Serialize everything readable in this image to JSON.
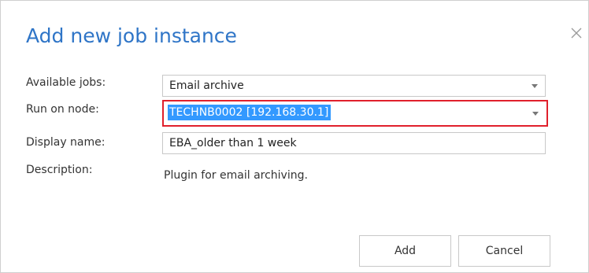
{
  "dialog": {
    "title": "Add new job instance",
    "close_icon": "close-icon"
  },
  "form": {
    "available_jobs": {
      "label": "Available jobs:",
      "value": "Email archive"
    },
    "run_on_node": {
      "label": "Run on node:",
      "value": "TECHNB0002 [192.168.30.1]"
    },
    "display_name": {
      "label": "Display name:",
      "value": "EBA_older than 1 week"
    },
    "description": {
      "label": "Description:",
      "value": "Plugin for email archiving."
    }
  },
  "buttons": {
    "add_label": "Add",
    "cancel_label": "Cancel"
  },
  "colors": {
    "title": "#2f75c7",
    "highlight_border": "#e0202c",
    "selection": "#3399ff"
  }
}
